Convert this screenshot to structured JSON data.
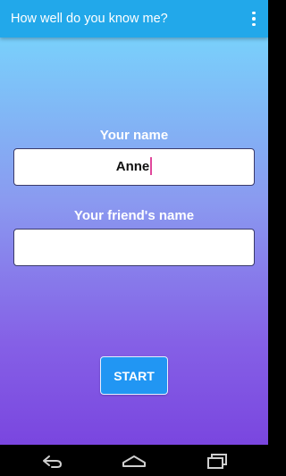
{
  "app": {
    "title": "How well do you know me?"
  },
  "form": {
    "your_name_label": "Your name",
    "your_name_value": "Anne",
    "friend_name_label": "Your friend's name",
    "friend_name_value": "",
    "start_label": "START"
  },
  "colors": {
    "appbar": "#22a8ea",
    "gradient_top": "#79d0fb",
    "gradient_bottom": "#7a46df",
    "button": "#2196f3",
    "cursor": "#e0479b"
  },
  "icons": {
    "overflow": "overflow-menu-icon",
    "back": "back-icon",
    "home": "home-icon",
    "recents": "recents-icon"
  }
}
